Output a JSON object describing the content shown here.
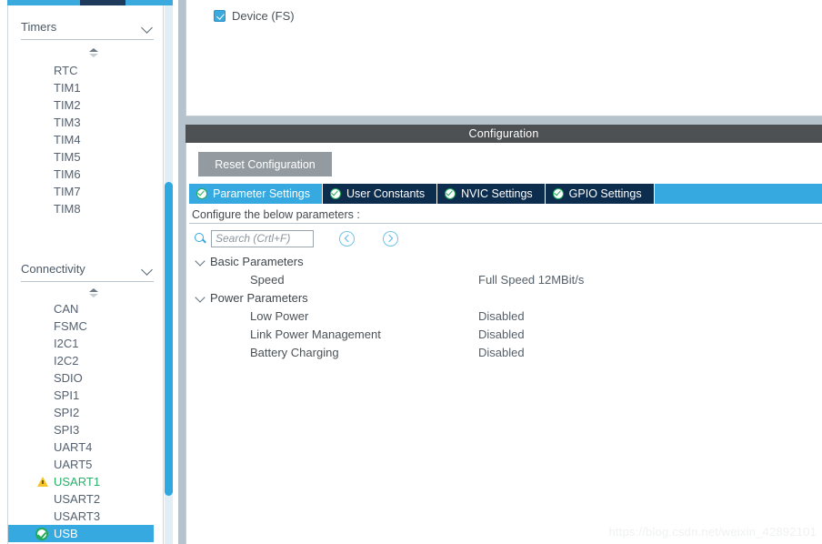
{
  "left_panel": {
    "sections": [
      {
        "name": "timers",
        "title": "Timers",
        "chevron_icon": "chevron-down-icon",
        "spinner_icon": "spinner-updown-icon",
        "items": [
          {
            "label": "RTC",
            "state": "none"
          },
          {
            "label": "TIM1",
            "state": "none"
          },
          {
            "label": "TIM2",
            "state": "none"
          },
          {
            "label": "TIM3",
            "state": "none"
          },
          {
            "label": "TIM4",
            "state": "none"
          },
          {
            "label": "TIM5",
            "state": "none"
          },
          {
            "label": "TIM6",
            "state": "none"
          },
          {
            "label": "TIM7",
            "state": "none"
          },
          {
            "label": "TIM8",
            "state": "none"
          }
        ]
      },
      {
        "name": "connectivity",
        "title": "Connectivity",
        "chevron_icon": "chevron-down-icon",
        "spinner_icon": "spinner-updown-icon",
        "items": [
          {
            "label": "CAN",
            "state": "none"
          },
          {
            "label": "FSMC",
            "state": "none"
          },
          {
            "label": "I2C1",
            "state": "none"
          },
          {
            "label": "I2C2",
            "state": "none"
          },
          {
            "label": "SDIO",
            "state": "none"
          },
          {
            "label": "SPI1",
            "state": "none"
          },
          {
            "label": "SPI2",
            "state": "none"
          },
          {
            "label": "SPI3",
            "state": "none"
          },
          {
            "label": "UART4",
            "state": "none"
          },
          {
            "label": "UART5",
            "state": "none"
          },
          {
            "label": "USART1",
            "state": "warning",
            "icon": "warning-triangle-icon"
          },
          {
            "label": "USART2",
            "state": "none"
          },
          {
            "label": "USART3",
            "state": "none"
          },
          {
            "label": "USB",
            "state": "selected",
            "icon": "check-circle-icon"
          }
        ]
      }
    ],
    "scrollbar": {
      "name": "vertical-scrollbar"
    }
  },
  "mode_panel": {
    "checkbox": {
      "label": "Device (FS)",
      "checked": true
    }
  },
  "configuration": {
    "title": "Configuration",
    "reset_button": "Reset Configuration",
    "tabs": [
      {
        "label": "Parameter Settings",
        "active": true,
        "icon": "check-circle-icon"
      },
      {
        "label": "User Constants",
        "active": false,
        "icon": "check-circle-icon"
      },
      {
        "label": "NVIC Settings",
        "active": false,
        "icon": "check-circle-icon"
      },
      {
        "label": "GPIO Settings",
        "active": false,
        "icon": "check-circle-icon"
      }
    ],
    "hint": "Configure the below parameters :",
    "search": {
      "placeholder": "Search (Crtl+F)",
      "value": "",
      "icon": "search-icon",
      "prev_icon": "chevron-left-circle-icon",
      "next_icon": "chevron-right-circle-icon"
    },
    "tree": [
      {
        "group": "Basic Parameters",
        "chevron_icon": "chevron-down-icon",
        "rows": [
          {
            "name": "Speed",
            "value": "Full Speed 12MBit/s"
          }
        ]
      },
      {
        "group": "Power Parameters",
        "chevron_icon": "chevron-down-icon",
        "rows": [
          {
            "name": "Low Power",
            "value": "Disabled"
          },
          {
            "name": "Link Power Management",
            "value": "Disabled"
          },
          {
            "name": "Battery Charging",
            "value": "Disabled"
          }
        ]
      }
    ]
  },
  "watermark": "https://blog.csdn.net/weixin_42892101",
  "colors": {
    "accent_blue": "#36a9e0",
    "tab_inactive": "#0d2d4e",
    "config_bar": "#4d5154",
    "warning_yellow": "#f5c425",
    "ok_green": "#1faa5a",
    "gutter_gray": "#b7c3cc"
  }
}
